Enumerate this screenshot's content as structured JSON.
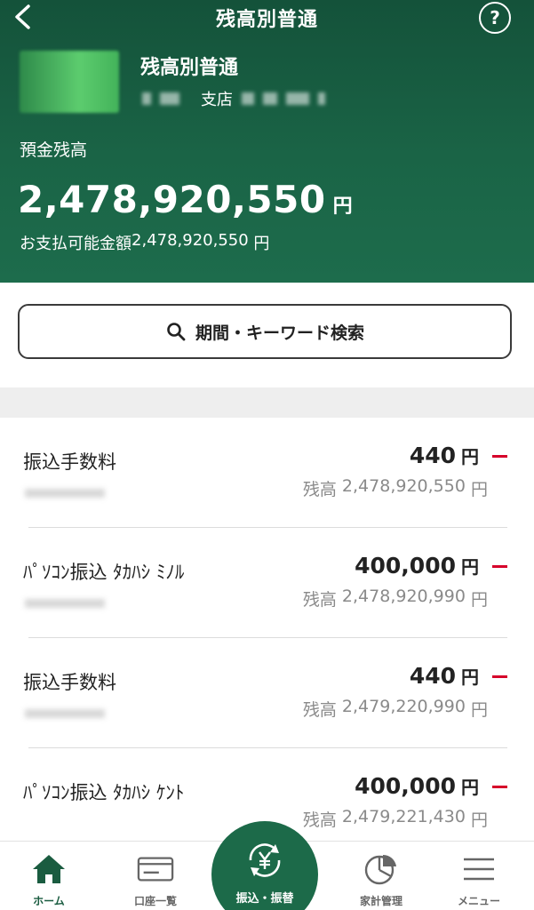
{
  "header": {
    "title": "残高別普通",
    "help_label": "?",
    "account_name": "残高別普通",
    "branch_label": "支店",
    "balance_label": "預金残高",
    "balance_amount": "2,478,920,550",
    "balance_unit": "円",
    "available_label": "お支払可能金額",
    "available_amount": "2,478,920,550",
    "available_unit": " 円"
  },
  "search": {
    "label": "期間・キーワード検索"
  },
  "transactions": [
    {
      "description": "振込手数料",
      "amount": "440",
      "unit": "円",
      "sign": "−",
      "balance_label": "残高",
      "balance": "2,478,920,550",
      "balance_unit": "円"
    },
    {
      "description": "ﾊﾟｿｺﾝ振込 ﾀｶﾊｼ ﾐﾉﾙ",
      "amount": "400,000",
      "unit": "円",
      "sign": "−",
      "balance_label": "残高",
      "balance": "2,478,920,990",
      "balance_unit": "円"
    },
    {
      "description": "振込手数料",
      "amount": "440",
      "unit": "円",
      "sign": "−",
      "balance_label": "残高",
      "balance": "2,479,220,990",
      "balance_unit": "円"
    },
    {
      "description": "ﾊﾟｿｺﾝ振込 ﾀｶﾊｼ ｹﾝﾄ",
      "amount": "400,000",
      "unit": "円",
      "sign": "−",
      "balance_label": "残高",
      "balance": "2,479,221,430",
      "balance_unit": "円"
    }
  ],
  "tabbar": {
    "items": [
      {
        "label": "ホーム",
        "icon": "home-icon"
      },
      {
        "label": "口座一覧",
        "icon": "card-icon"
      },
      {
        "label": "振込・振替",
        "icon": "yen-transfer-icon"
      },
      {
        "label": "家計管理",
        "icon": "pie-chart-icon"
      },
      {
        "label": "メニュー",
        "icon": "menu-icon"
      }
    ]
  },
  "colors": {
    "header_green": "#1a6446",
    "fab_green": "#1c6a49",
    "minus_red": "#d6002a"
  }
}
